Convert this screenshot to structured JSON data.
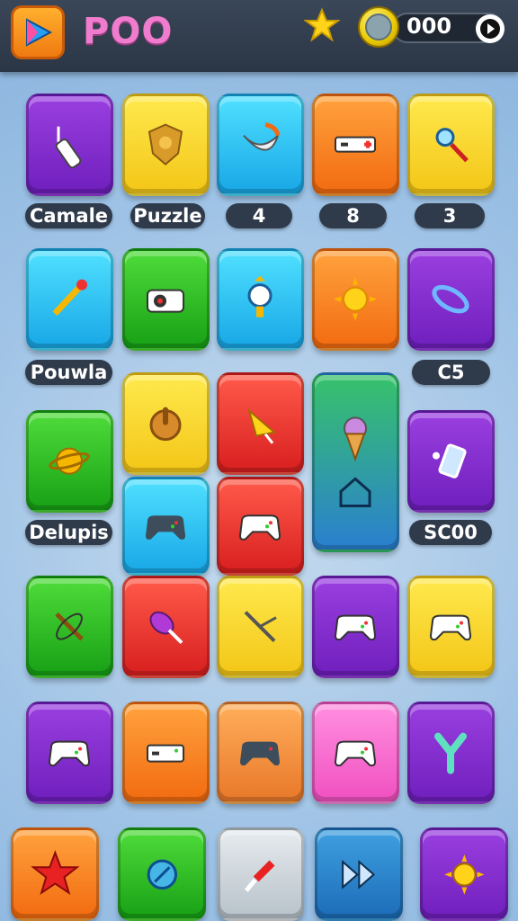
{
  "header": {
    "title": "POO",
    "coin_value": "000"
  },
  "labels": {
    "r1c1": "Camale",
    "r1c2": "Puzzle",
    "r1c3": "4",
    "r1c4": "8",
    "r1c5": "3",
    "r2c1": "Pouwla",
    "r2c5": "C5",
    "r3c1": "Delupis",
    "r3c5": "SC00"
  },
  "icons": {
    "app": "play-arrow-icon",
    "star": "star-icon",
    "coin": "coin-icon",
    "next": "play-circle-icon"
  },
  "colors": {
    "title": "#f07ccd",
    "topbar": "#2f3a4b",
    "background": "#9fc3e6"
  }
}
